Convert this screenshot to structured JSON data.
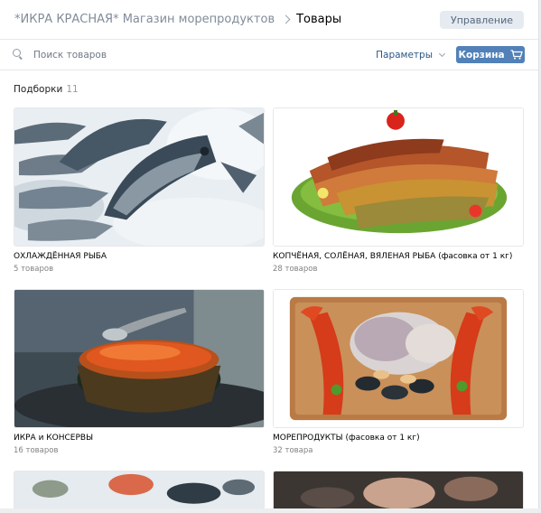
{
  "header": {
    "shop_name": "*ИКРА КРАСНАЯ* Магазин морепродуктов",
    "current": "Товары",
    "manage_label": "Управление"
  },
  "toolbar": {
    "search_placeholder": "Поиск товаров",
    "params_label": "Параметры",
    "cart_label": "Корзина"
  },
  "section": {
    "title": "Подборки",
    "count": "11"
  },
  "albums": [
    {
      "title": "ОХЛАЖДЁННАЯ РЫБА",
      "count": "5 товаров"
    },
    {
      "title": "КОПЧЁНАЯ, СОЛЁНАЯ, ВЯЛЕНАЯ РЫБА (фасовка от 1 кг)",
      "count": "28 товаров"
    },
    {
      "title": "ИКРА и КОНСЕРВЫ",
      "count": "16 товаров"
    },
    {
      "title": "МОРЕПРОДУКТЫ (фасовка от 1 кг)",
      "count": "32 товара"
    }
  ],
  "colors": {
    "accent": "#5181b8",
    "link": "#2a5885",
    "muted": "#828282"
  }
}
